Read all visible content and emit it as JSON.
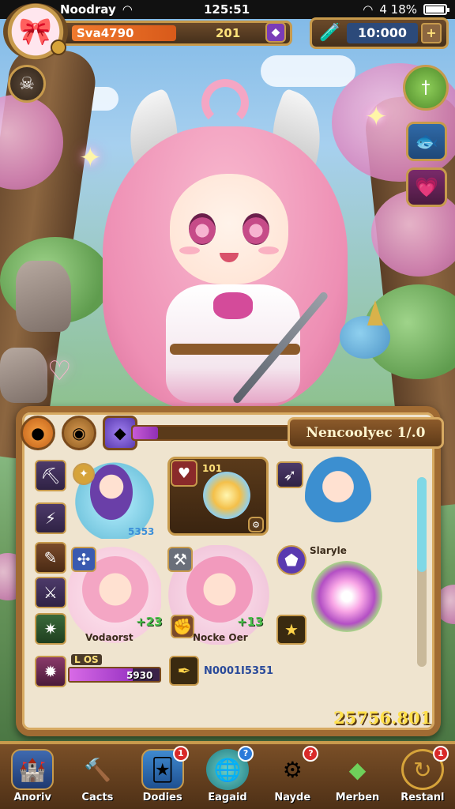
{
  "status_bar": {
    "carrier": "Noodray",
    "time": "125:51",
    "battery_text": "4 18%",
    "battery_level": 0.9
  },
  "player": {
    "name": "Sva4790",
    "level": "201",
    "avatar_icon": "pink-haired-girl-portrait"
  },
  "currency": {
    "icon": "potion-bottles-icon",
    "value": "10:000",
    "add_label": "+"
  },
  "left_buttons": [
    {
      "icon": "skull-shield-icon"
    }
  ],
  "right_buttons": [
    {
      "icon": "sword-icon",
      "glyph": "†"
    },
    {
      "icon": "fish-icon",
      "glyph": "🐟"
    },
    {
      "icon": "heart-icon",
      "glyph": "💗"
    }
  ],
  "panel": {
    "tab_title": "Nencoolyec 1/.0",
    "progress": 0.15,
    "top_icons": [
      "orange-orb-icon",
      "eye-shield-icon",
      "purple-crystal-icon"
    ],
    "cards": [
      {
        "name": "purple-haired-mage",
        "stat": "5353",
        "stat_color": "#3c8fd8"
      },
      {
        "name": "heart-slot",
        "stat": "101"
      },
      {
        "name": "blue-haired-swordswoman",
        "label": "Slaryle"
      },
      {
        "name": "pink-girl-one",
        "label": "Vodaorst",
        "stat": "+23"
      },
      {
        "name": "pink-girl-two",
        "label": "Nocke Oer",
        "stat": "+13"
      },
      {
        "name": "magic-burst"
      }
    ],
    "bottom_left": {
      "label": "L OS",
      "value": "5930",
      "progress": 0.7
    },
    "bottom_mid": {
      "value": "N0001I5351"
    },
    "gold_total": "25756.801",
    "scroll_position": 0.0
  },
  "nav": [
    {
      "label": "Anoriv",
      "icon": "castle-icon",
      "badge": ""
    },
    {
      "label": "Cacts",
      "icon": "hammer-icon",
      "badge": ""
    },
    {
      "label": "Dodies",
      "icon": "card-icon",
      "badge": "1"
    },
    {
      "label": "Eagaid",
      "icon": "globe-icon",
      "badge": "?"
    },
    {
      "label": "Nayde",
      "icon": "gear-gem-icon",
      "badge": "?"
    },
    {
      "label": "Merben",
      "icon": "green-crystal-icon",
      "badge": ""
    },
    {
      "label": "Restanl",
      "icon": "refresh-icon",
      "badge": "1"
    }
  ]
}
